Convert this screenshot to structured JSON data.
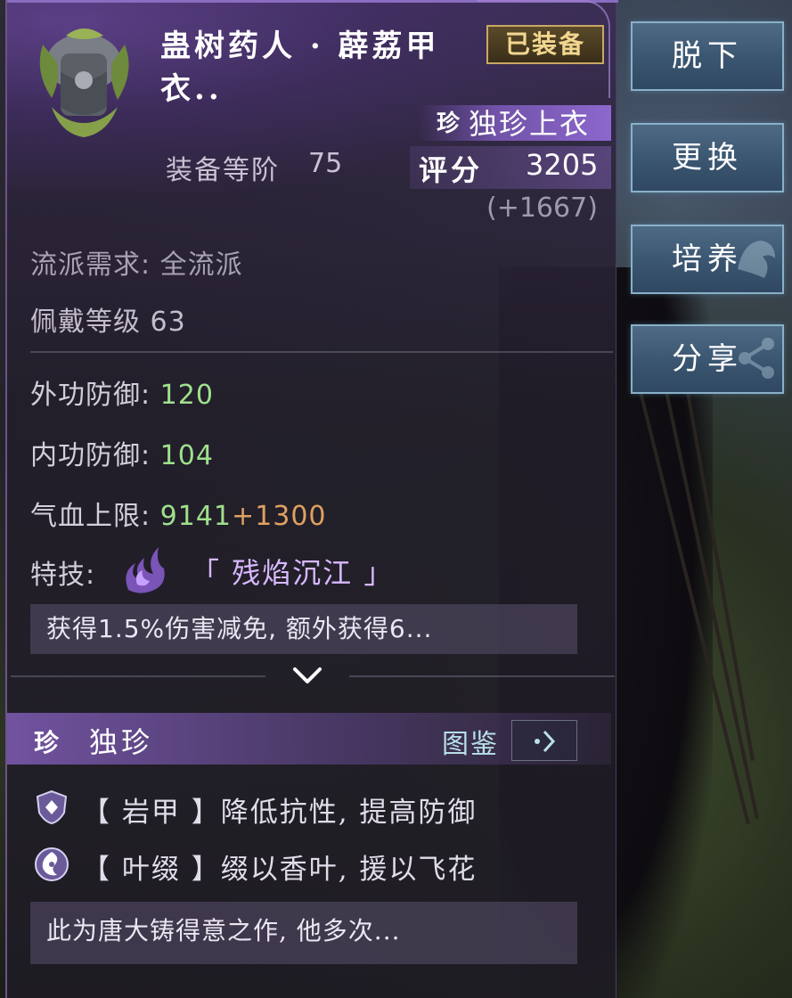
{
  "item": {
    "name": "蛊树药人 · 薜荔甲衣..",
    "equipped_badge": "已装备",
    "rarity_glyph": "珍",
    "rarity_type": "独珍上衣",
    "tier_label": "装备等阶",
    "tier_value": "75",
    "score_label": "评分",
    "score_value": "3205",
    "score_delta": "(+1667)"
  },
  "requirements": {
    "school": "流派需求: 全流派",
    "wear_level": "佩戴等级 63"
  },
  "attributes": {
    "outer_def_label": "外功防御: ",
    "outer_def_value": "120",
    "inner_def_label": "内功防御: ",
    "inner_def_value": "104",
    "hp_label": "气血上限: ",
    "hp_value": "9141",
    "hp_bonus": "+1300",
    "skill_label": "特技: ",
    "skill_name": "「 残焰沉江 」",
    "skill_desc": "获得1.5%伤害减免, 额外获得6..."
  },
  "set": {
    "glyph": "珍",
    "name": "独珍",
    "codex_label": "图鉴",
    "effects": [
      {
        "icon": "shield-crest-icon",
        "text": "【 岩甲 】降低抗性, 提高防御"
      },
      {
        "icon": "swirl-leaf-icon",
        "text": "【 叶缀 】缀以香叶, 援以飞花"
      }
    ],
    "lore": "此为唐大铸得意之作, 他多次..."
  },
  "actions": {
    "unequip": "脱下",
    "replace": "更换",
    "cultivate": "培养",
    "share": "分享"
  },
  "colors": {
    "stat_value": "#9fe08c",
    "stat_bonus": "#e0a060",
    "skill_name": "#d8b8ff",
    "equipped_gold": "#c8a864"
  }
}
